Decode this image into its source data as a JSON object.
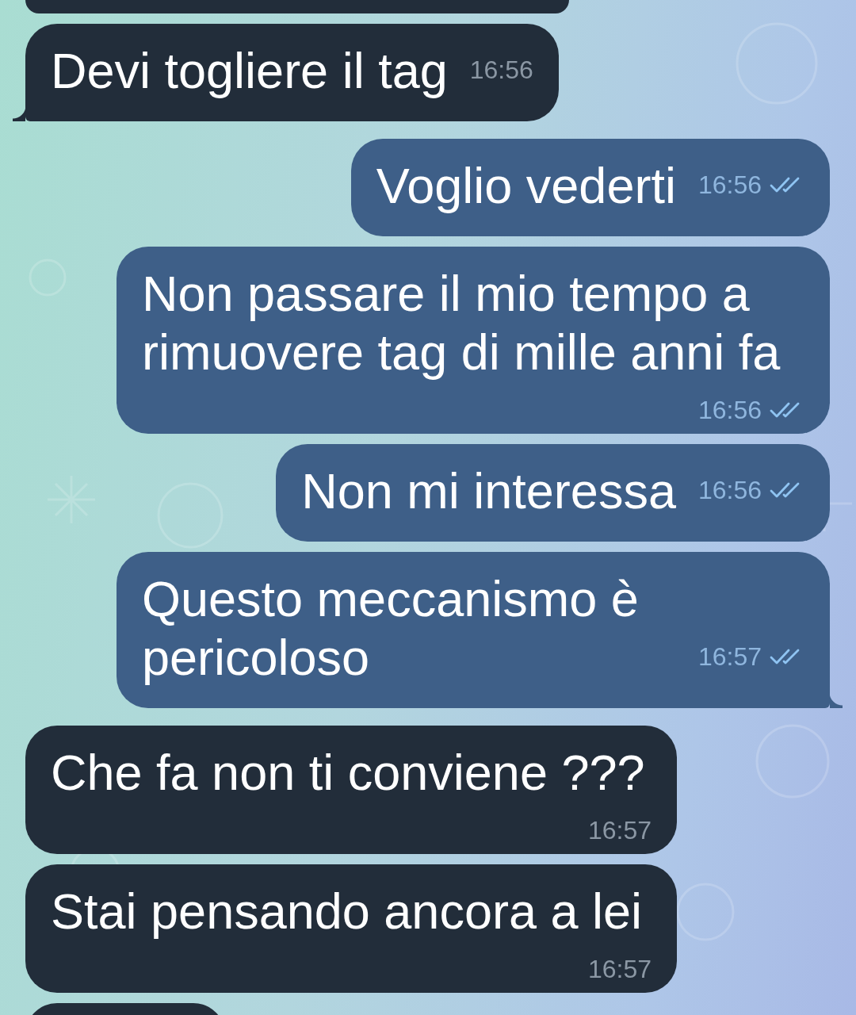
{
  "messages": [
    {
      "outgoing": false,
      "kind": "partial"
    },
    {
      "outgoing": false,
      "kind": "text",
      "text": "Devi togliere il tag",
      "time": "16:56",
      "tail": true
    },
    {
      "outgoing": true,
      "kind": "text",
      "text": "Voglio vederti",
      "time": "16:56",
      "read": true,
      "tail": false
    },
    {
      "outgoing": true,
      "kind": "text",
      "text": "Non passare il mio tempo a rimuovere tag di mille anni fa",
      "time": "16:56",
      "read": true,
      "tail": false
    },
    {
      "outgoing": true,
      "kind": "text",
      "text": "Non mi interessa",
      "time": "16:56",
      "read": true,
      "tail": false
    },
    {
      "outgoing": true,
      "kind": "text",
      "text": "Questo meccanismo è pericoloso",
      "time": "16:57",
      "read": true,
      "tail": true
    },
    {
      "outgoing": false,
      "kind": "text",
      "text": "Che fa non ti conviene ???",
      "time": "16:57",
      "tail": false
    },
    {
      "outgoing": false,
      "kind": "text",
      "text": "Stai pensando ancora a lei",
      "time": "16:57",
      "tail": false
    },
    {
      "outgoing": false,
      "kind": "partial"
    }
  ]
}
